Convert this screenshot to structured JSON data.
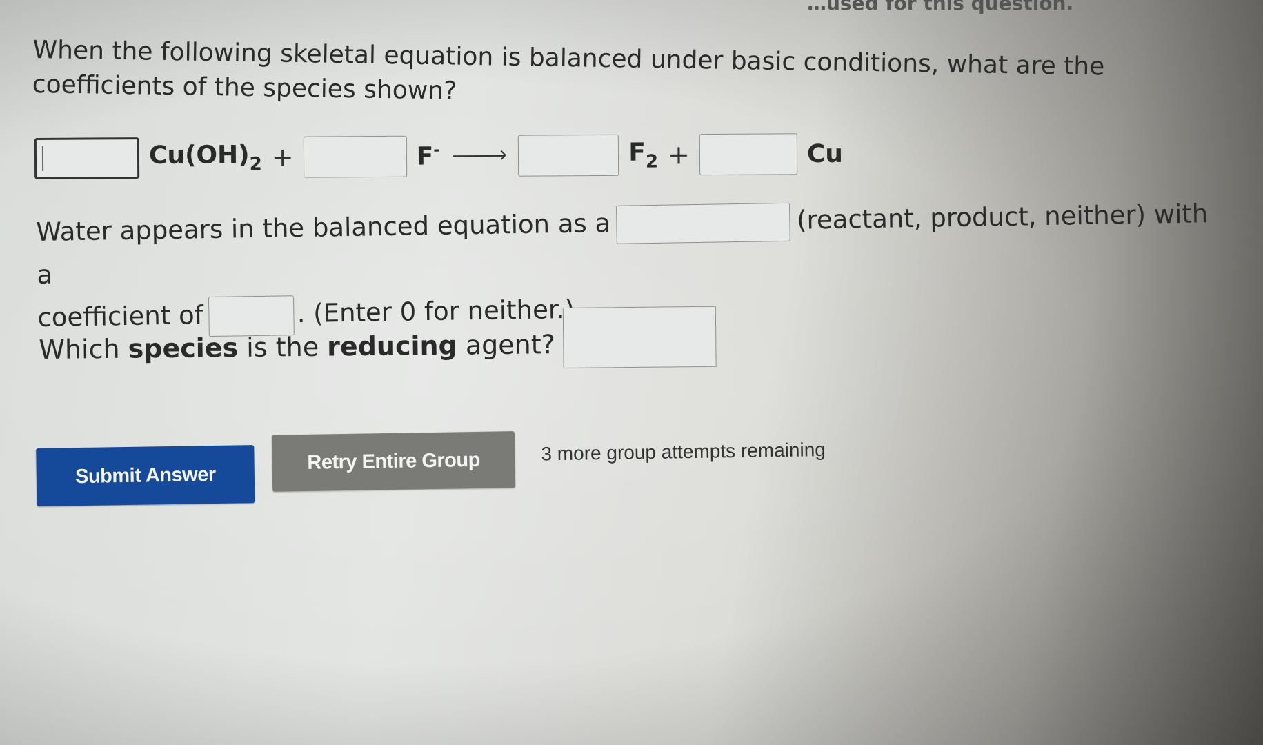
{
  "header_cutoff_text": "…used for this question.",
  "question": {
    "prompt": "When the following skeletal equation is balanced under basic conditions, what are the coefficients of the species shown?"
  },
  "equation": {
    "reactants": [
      {
        "coefficient_value": "",
        "species_base": "Cu(OH)",
        "species_sub": "2",
        "species_sup": ""
      },
      {
        "coefficient_value": "",
        "species_base": "F",
        "species_sub": "",
        "species_sup": "-"
      }
    ],
    "products": [
      {
        "coefficient_value": "",
        "species_base": "F",
        "species_sub": "2",
        "species_sup": ""
      },
      {
        "coefficient_value": "",
        "species_base": "Cu",
        "species_sub": "",
        "species_sup": ""
      }
    ],
    "plus_sign": "+",
    "arrow_icon": "right-arrow"
  },
  "water": {
    "text_before": "Water appears in the balanced equation as a",
    "role_value": "",
    "role_hint": "(reactant, product, neither) with a",
    "text_coef": "coefficient of",
    "coef_value": "",
    "text_after": ". (Enter 0 for neither.)"
  },
  "reducing_agent": {
    "text_1": "Which",
    "bold_1": "species",
    "text_2": "is the",
    "bold_2": "reducing",
    "text_3": "agent?",
    "value": ""
  },
  "actions": {
    "submit_label": "Submit Answer",
    "retry_label": "Retry Entire Group",
    "attempts_text": "3 more group attempts remaining"
  },
  "colors": {
    "submit_button": "#154a9a",
    "retry_button": "#7a7a77"
  }
}
